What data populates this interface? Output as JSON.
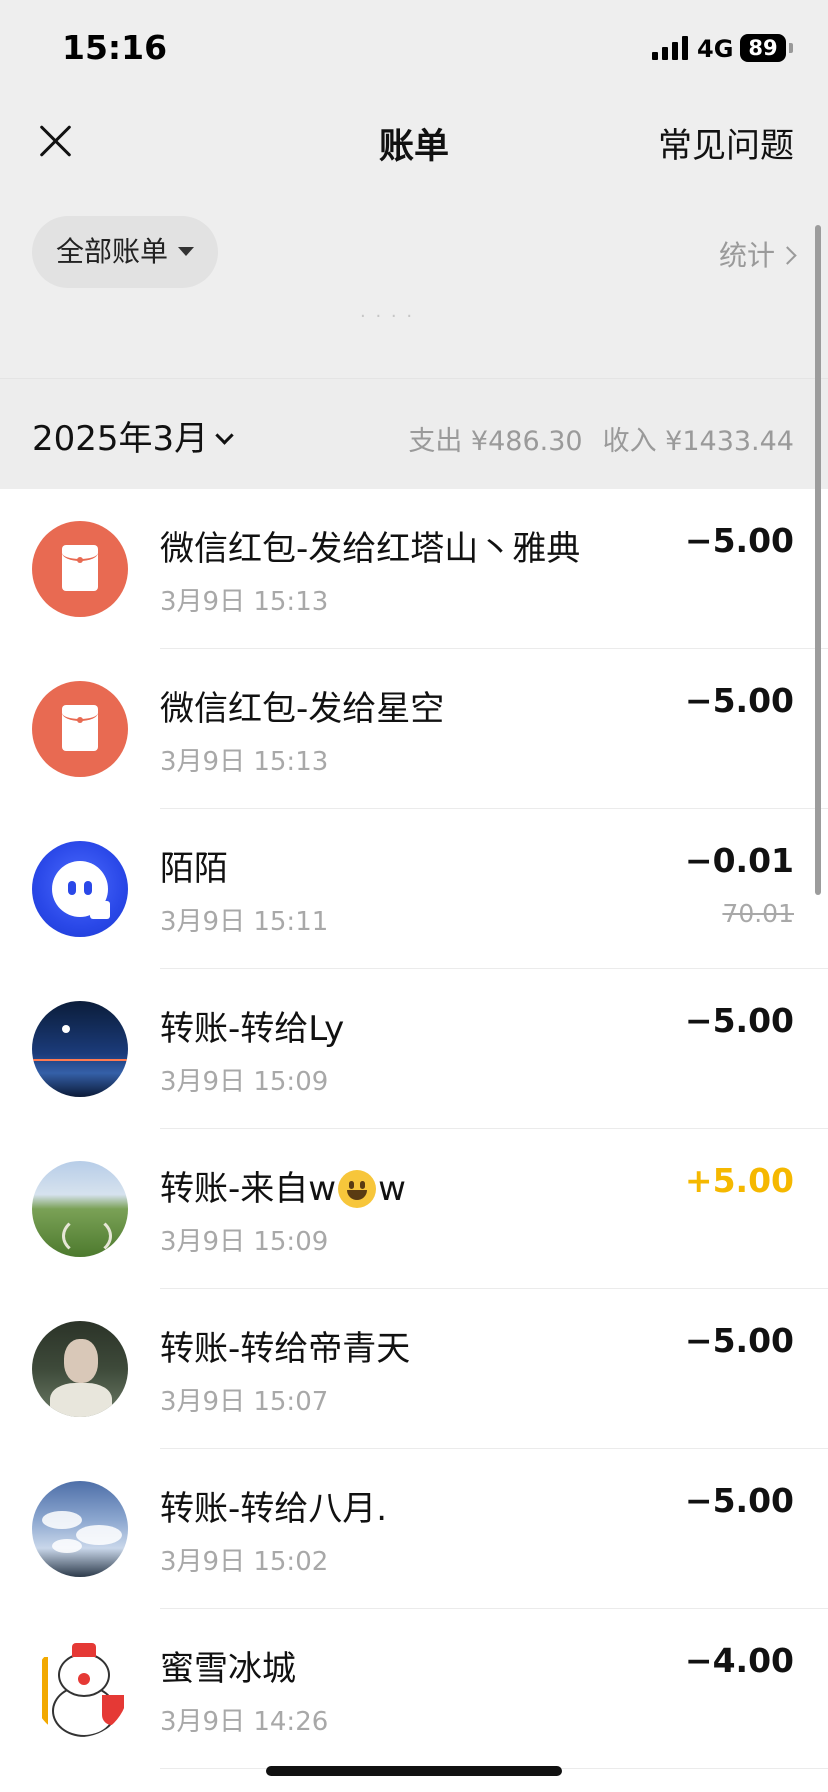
{
  "status_bar": {
    "time": "15:16",
    "network": "4G",
    "battery": "89"
  },
  "nav": {
    "title": "账单",
    "faq_label": "常见问题"
  },
  "filter": {
    "label": "全部账单"
  },
  "stats": {
    "label": "统计"
  },
  "month_section": {
    "month_label": "2025年3月",
    "expense_label": "支出 ¥486.30",
    "income_label": "收入 ¥1433.44"
  },
  "transactions": [
    {
      "name": "微信红包-发给红塔山丶雅典",
      "time": "3月9日 15:13",
      "amount": "−5.00",
      "avatar": "red-packet-icon"
    },
    {
      "name": "微信红包-发给星空",
      "time": "3月9日 15:13",
      "amount": "−5.00",
      "avatar": "red-packet-icon"
    },
    {
      "name": "陌陌",
      "time": "3月9日 15:11",
      "amount": "−0.01",
      "original_amount": "70.01",
      "avatar": "momo-logo"
    },
    {
      "name": "转账-转给Ly",
      "time": "3月9日 15:09",
      "amount": "−5.00",
      "avatar": "night-photo"
    },
    {
      "name_prefix": "转账-来自w",
      "name_emoji": "grinning-face-emoji",
      "name_suffix": "w",
      "time": "3月9日 15:09",
      "amount": "+5.00",
      "avatar": "grassland-photo"
    },
    {
      "name": "转账-转给帝青天",
      "time": "3月9日 15:07",
      "amount": "−5.00",
      "avatar": "portrait-photo"
    },
    {
      "name": "转账-转给八月.",
      "time": "3月9日 15:02",
      "amount": "−5.00",
      "avatar": "sky-photo"
    },
    {
      "name": "蜜雪冰城",
      "time": "3月9日 14:26",
      "amount": "−4.00",
      "avatar": "mixue-snowman-logo"
    }
  ],
  "colors": {
    "income": "#f5b800",
    "red_packet": "#e86a52",
    "momo_blue": "#2a48e8",
    "background_gray": "#eeeeee"
  }
}
